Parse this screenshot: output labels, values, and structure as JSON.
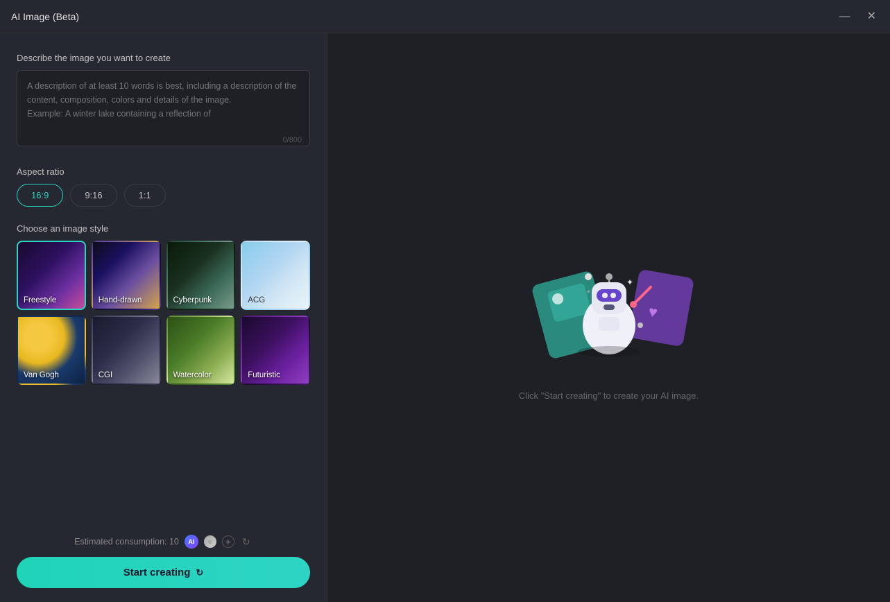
{
  "window": {
    "title": "AI Image (Beta)",
    "minimize_label": "minimize",
    "close_label": "close"
  },
  "left": {
    "describe_label": "Describe the image you want to create",
    "textarea_placeholder": "A description of at least 10 words is best, including a description of the content, composition, colors and details of the image.\nExample: A winter lake containing a reflection of",
    "char_count": "0/800",
    "aspect_ratio_label": "Aspect ratio",
    "aspect_options": [
      {
        "value": "16:9",
        "active": true
      },
      {
        "value": "9:16",
        "active": false
      },
      {
        "value": "1:1",
        "active": false
      }
    ],
    "style_label": "Choose an image style",
    "styles": [
      {
        "id": "freestyle",
        "label": "Freestyle",
        "active": true,
        "class": "style-freestyle"
      },
      {
        "id": "hand-drawn",
        "label": "Hand-drawn",
        "active": false,
        "class": "style-hand-drawn"
      },
      {
        "id": "cyberpunk",
        "label": "Cyberpunk",
        "active": false,
        "class": "style-cyberpunk"
      },
      {
        "id": "acg",
        "label": "ACG",
        "active": false,
        "class": "style-acg"
      },
      {
        "id": "van-gogh",
        "label": "Van Gogh",
        "active": false,
        "class": "style-van-gogh"
      },
      {
        "id": "cgi",
        "label": "CGI",
        "active": false,
        "class": "style-cgi"
      },
      {
        "id": "watercolor",
        "label": "Watercolor",
        "active": false,
        "class": "style-watercolor"
      },
      {
        "id": "futuristic",
        "label": "Futuristic",
        "active": false,
        "class": "style-futuristic"
      }
    ],
    "consumption_text": "Estimated consumption: 10",
    "start_btn_label": "Start creating"
  },
  "right": {
    "hint_text": "Click \"Start creating\" to create your AI image."
  }
}
